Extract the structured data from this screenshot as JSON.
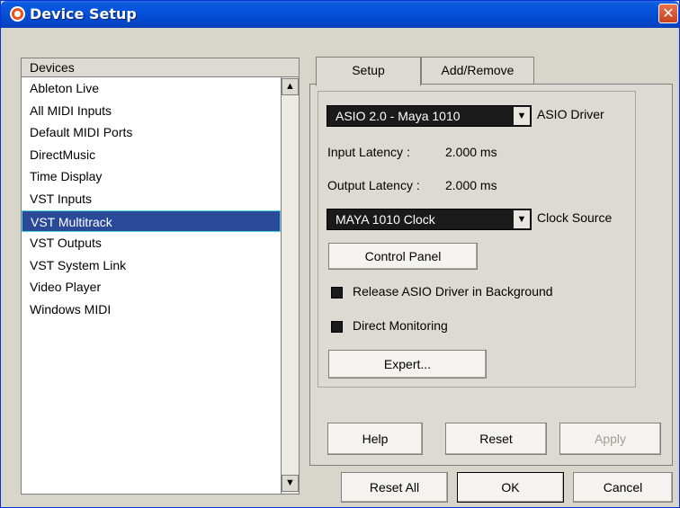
{
  "window": {
    "title": "Device Setup",
    "close_label": "✕"
  },
  "devices": {
    "header": "Devices",
    "items": [
      "Ableton Live",
      "All MIDI Inputs",
      "Default MIDI Ports",
      "DirectMusic",
      "Time Display",
      "VST Inputs",
      "VST Multitrack",
      "VST Outputs",
      "VST System Link",
      "Video Player",
      "Windows MIDI"
    ],
    "selected": "VST Multitrack",
    "scroll_up": "▲",
    "scroll_down": "▼"
  },
  "tabs": {
    "setup": "Setup",
    "add_remove": "Add/Remove"
  },
  "setup": {
    "driver_value": "ASIO 2.0 - Maya 1010",
    "driver_label": "ASIO Driver",
    "input_latency_label": "Input Latency :",
    "input_latency_value": "2.000 ms",
    "output_latency_label": "Output Latency :",
    "output_latency_value": "2.000 ms",
    "clock_value": "MAYA 1010 Clock",
    "clock_label": "Clock Source",
    "control_panel": "Control Panel",
    "release_driver": "Release ASIO Driver in Background",
    "direct_monitoring": "Direct Monitoring",
    "expert": "Expert...",
    "dd_arrow": "▼"
  },
  "panel_buttons": {
    "help": "Help",
    "reset": "Reset",
    "apply": "Apply"
  },
  "dialog_buttons": {
    "reset_all": "Reset All",
    "ok": "OK",
    "cancel": "Cancel"
  }
}
